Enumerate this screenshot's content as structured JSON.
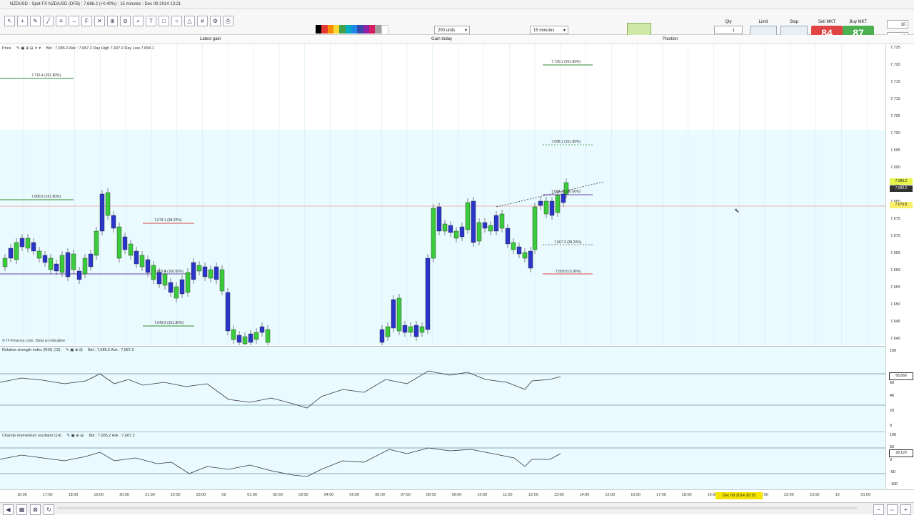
{
  "window": {
    "title": "NZDUSD - Spot FX NZD/USD (DFB) : 7,686.2 (+0.40%) : 15 minutes : Dec 09 2014 13:21"
  },
  "toolbar": {
    "units_value": "200 units",
    "timeframe_value": "15 minutes",
    "qty_label": "Qty",
    "limit_label": "Limit",
    "stop_label": "Stop",
    "sell_label": "Sell MKT",
    "buy_label": "Buy MKT",
    "sell_price": "84",
    "buy_price": "87",
    "qty_value": "1",
    "zoom_top": "10",
    "zoom_bottom": "10",
    "colors": {
      "sell": "#e04444",
      "buy": "#4caf50"
    }
  },
  "subbar": {
    "left": "Latest gain",
    "mid": "Gain today",
    "right": "Position"
  },
  "price_pane": {
    "title": "Price",
    "info": "Bid : 7,685.2  Ask : 7,687.2  Day High 7,697.9  Day Low 7,658.1",
    "status": "© IT-Finance.com. Data is indicative",
    "y_labels": [
      "7,725",
      "7,720",
      "7,715",
      "7,710",
      "7,705",
      "7,700",
      "7,695",
      "7,690",
      "7,685",
      "7,680",
      "7,675",
      "7,670",
      "7,665",
      "7,660",
      "7,655",
      "7,650",
      "7,645",
      "7,640"
    ],
    "last_bid": "7,686.2",
    "last_tag": "7,686.2",
    "line_price": "7,679.8",
    "fibs": [
      {
        "text": "7,716.4 (261.80%)"
      },
      {
        "text": "7,680.8 (161.80%)"
      },
      {
        "text": "7,674.1 (38.20%)"
      },
      {
        "text": "7,662.4 (100.00%)"
      },
      {
        "text": "7,643.9 (161.80%)"
      },
      {
        "text": "7,720.1 (261.80%)"
      },
      {
        "text": "7,698.1 (161.80%)"
      },
      {
        "text": "7,684.7 (100.00%)"
      },
      {
        "text": "7,667.3 (38.20%)"
      },
      {
        "text": "7,659.8 (0.00%)"
      }
    ]
  },
  "rsi_pane": {
    "title": "Relative strength index (RSI) (12)",
    "info": "Bid : 7,685.2  Ask : 7,687.2",
    "y_labels": [
      "100",
      "60",
      "40",
      "20",
      "0"
    ],
    "current": "65.869"
  },
  "cmo_pane": {
    "title": "Chande momentum oscillator (14)",
    "info": "Bid : 7,685.2  Ask : 7,687.2",
    "y_labels": [
      "100",
      "50",
      "0",
      "-50",
      "-100"
    ],
    "current": "28.120"
  },
  "time_axis": {
    "labels": [
      "16:00",
      "17:00",
      "18:00",
      "19:00",
      "20:00",
      "21:00",
      "22:00",
      "23:00",
      "09",
      "01:00",
      "02:00",
      "03:00",
      "04:00",
      "05:00",
      "06:00",
      "07:00",
      "08:00",
      "09:00",
      "10:00",
      "11:00",
      "12:00",
      "13:00",
      "14:00",
      "15:00",
      "16:00",
      "17:00",
      "18:00",
      "19:00",
      "",
      "21:00",
      "22:00",
      "23:00",
      "10",
      "01:00"
    ],
    "highlight": "Dec 09 2014 20:15"
  }
}
